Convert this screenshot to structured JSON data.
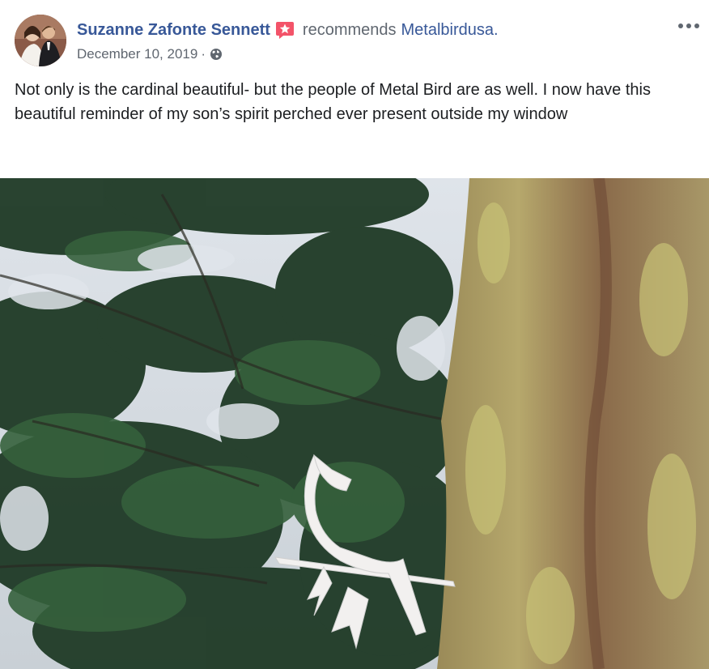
{
  "post": {
    "author_name": "Suzanne Zafonte Sennett",
    "recommends_label": "recommends",
    "page_name": "Metalbirdusa.",
    "date": "December 10, 2019",
    "separator": "·",
    "privacy_icon": "globe-icon",
    "recommend_icon": "recommendation-star-icon",
    "more_icon": "more-options-icon",
    "text": "Not only is the cardinal beautiful- but the people of Metal Bird are as well. I now have this beautiful reminder of my son’s spirit perched ever present outside my window"
  },
  "colors": {
    "link_blue": "#385898",
    "muted_gray": "#606770",
    "text_dark": "#1c1e21",
    "recommend_red": "#f35369"
  }
}
